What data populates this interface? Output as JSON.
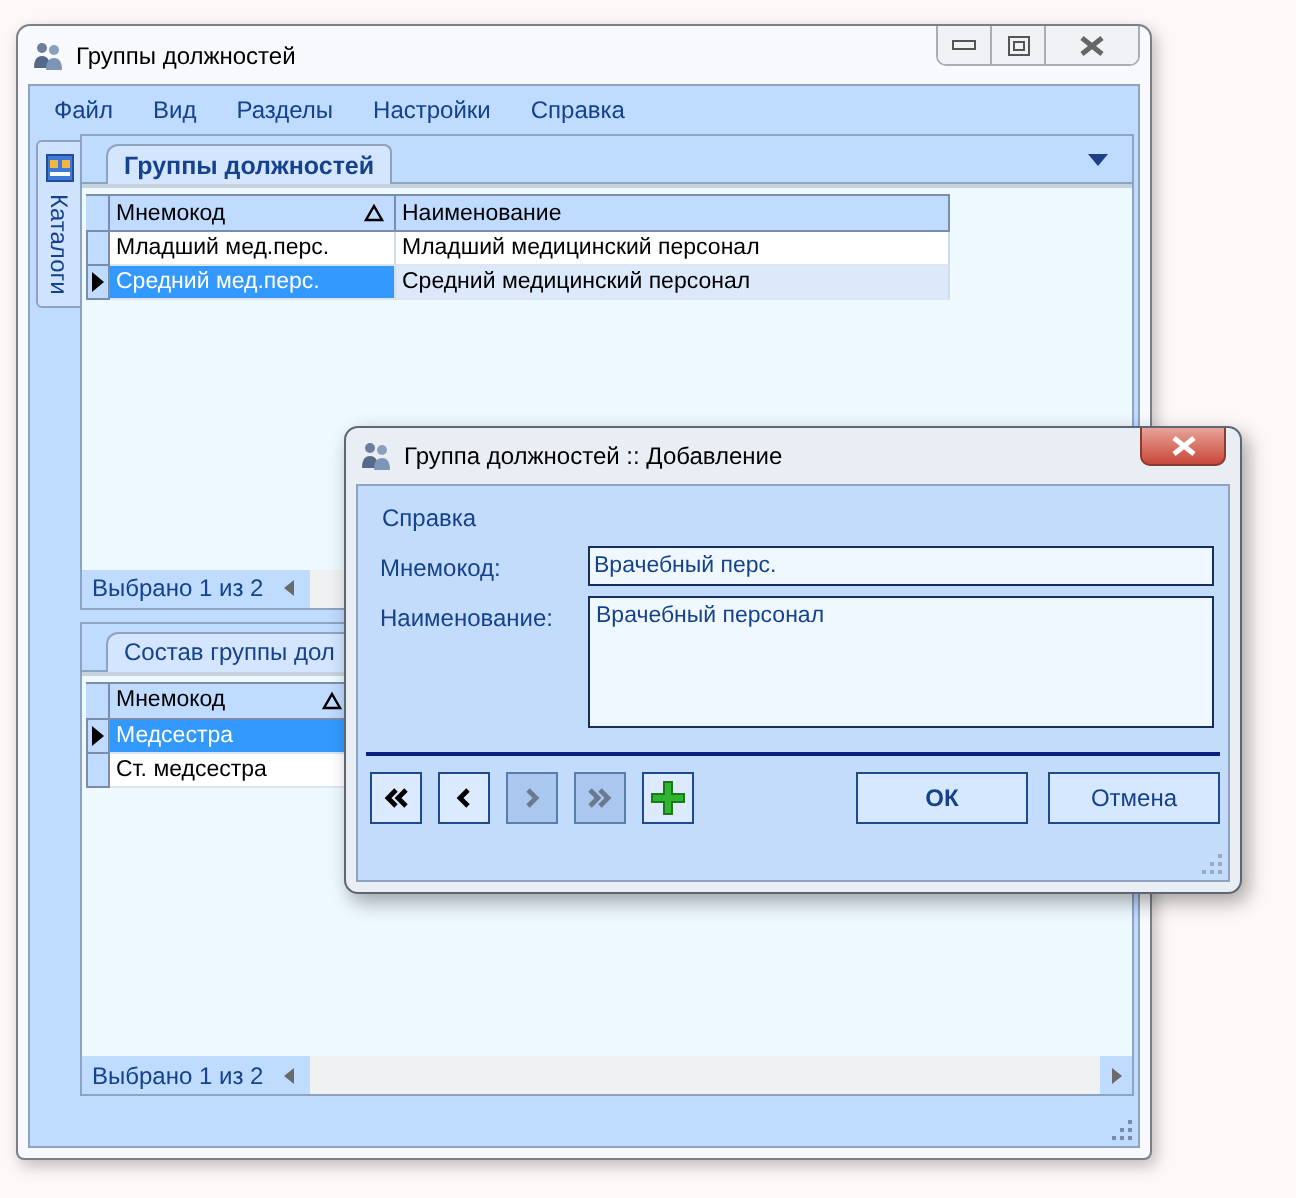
{
  "window": {
    "title": "Группы должностей"
  },
  "menu": [
    "Файл",
    "Вид",
    "Разделы",
    "Настройки",
    "Справка"
  ],
  "side_tab": {
    "label": "Каталоги"
  },
  "upper_panel": {
    "tab": "Группы должностей",
    "active": true,
    "columns": [
      {
        "label": "Мнемокод",
        "sorted": true
      },
      {
        "label": "Наименование",
        "sorted": false
      }
    ],
    "rows": [
      {
        "cells": [
          "Младший мед.перс.",
          "Младший медицинский персонал"
        ],
        "selected": false
      },
      {
        "cells": [
          "Средний мед.перс.",
          "Средний медицинский персонал"
        ],
        "selected": true
      }
    ],
    "status": "Выбрано 1 из 2"
  },
  "lower_panel": {
    "tab": "Состав группы дол",
    "active": false,
    "columns": [
      {
        "label": "Мнемокод",
        "sorted": true
      }
    ],
    "rows": [
      {
        "cells": [
          "Медсестра"
        ],
        "selected": true
      },
      {
        "cells": [
          "Ст. медсестра"
        ],
        "selected": false
      }
    ],
    "status": "Выбрано 1 из 2"
  },
  "dialog": {
    "title": "Группа должностей :: Добавление",
    "menu": [
      "Справка"
    ],
    "fields": [
      {
        "label": "Мнемокод:",
        "value": "Врачебный перс.",
        "kind": "line"
      },
      {
        "label": "Наименование:",
        "value": "Врачебный персонал",
        "kind": "multiline"
      }
    ],
    "nav_buttons": [
      {
        "kind": "first",
        "disabled": false
      },
      {
        "kind": "prev",
        "disabled": false
      },
      {
        "kind": "next",
        "disabled": true
      },
      {
        "kind": "last",
        "disabled": true
      },
      {
        "kind": "add",
        "disabled": false
      }
    ],
    "buttons": [
      {
        "label": "ОК",
        "default": true
      },
      {
        "label": "Отмена",
        "default": false
      }
    ]
  }
}
